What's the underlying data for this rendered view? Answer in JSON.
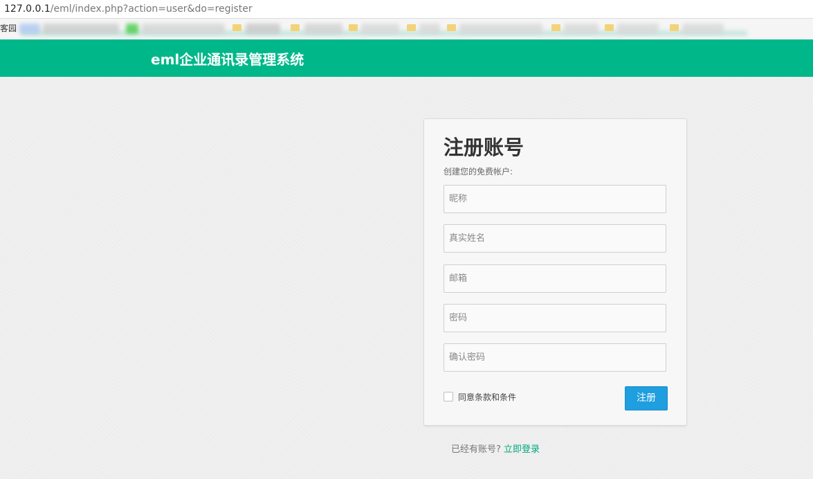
{
  "browser": {
    "address_host": "127.0.0.1",
    "address_path": "/eml/index.php?action=user&do=register",
    "bookmarks_visible_text": "客园"
  },
  "header": {
    "title": "eml企业通讯录管理系统",
    "background_color": "#00b78a"
  },
  "register": {
    "title": "注册账号",
    "subtitle": "创建您的免费帐户:",
    "fields": [
      {
        "name": "nickname",
        "placeholder": "昵称",
        "value": ""
      },
      {
        "name": "realname",
        "placeholder": "真实姓名",
        "value": ""
      },
      {
        "name": "email",
        "placeholder": "邮箱",
        "value": ""
      },
      {
        "name": "password",
        "placeholder": "密码",
        "value": ""
      },
      {
        "name": "confirm_password",
        "placeholder": "确认密码",
        "value": ""
      }
    ],
    "agree_label": "同意条款和条件",
    "agree_checked": false,
    "submit_label": "注册",
    "submit_color": "#1f9ee0"
  },
  "footer": {
    "prompt": "已经有账号?",
    "login_link": "立即登录",
    "link_color": "#00a97f"
  }
}
